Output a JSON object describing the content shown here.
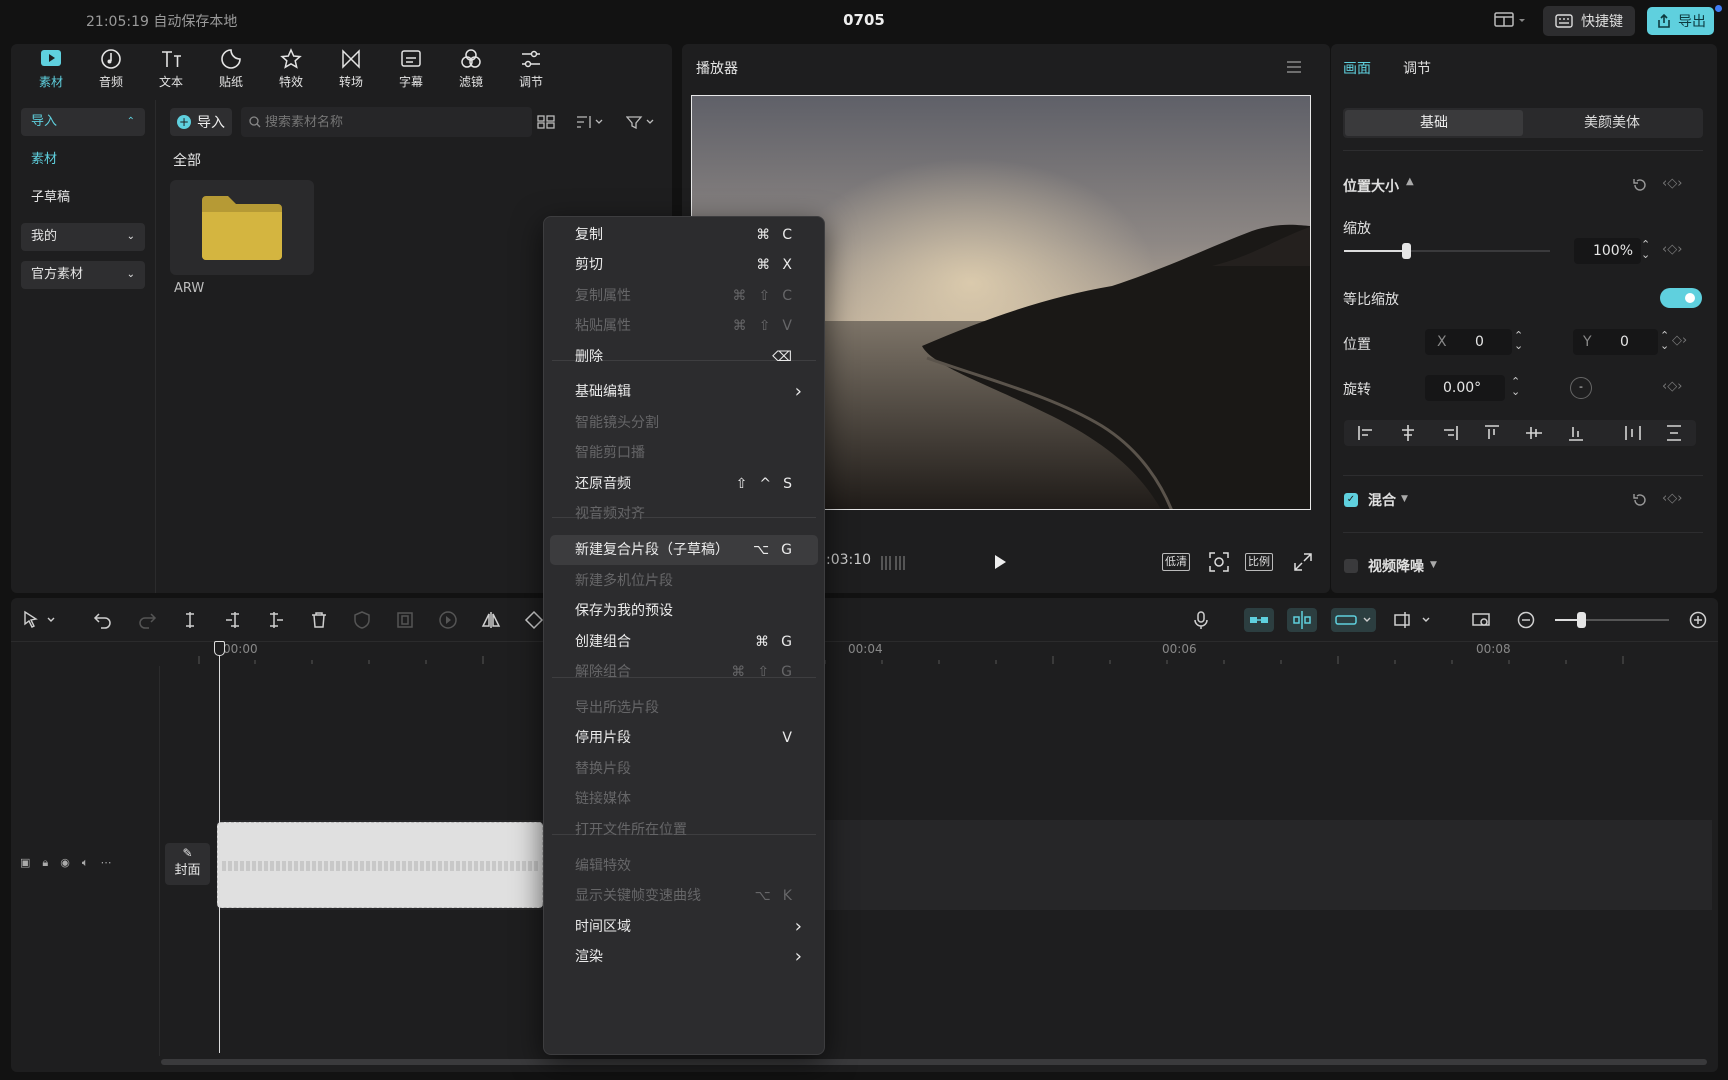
{
  "topbar": {
    "status": "21:05:19 自动保存本地",
    "project_title": "0705",
    "shortcut_label": "快捷键",
    "export_label": "导出"
  },
  "media_tabs": [
    {
      "label": "素材",
      "icon": "media-icon"
    },
    {
      "label": "音频",
      "icon": "audio-icon"
    },
    {
      "label": "文本",
      "icon": "text-icon"
    },
    {
      "label": "贴纸",
      "icon": "sticker-icon"
    },
    {
      "label": "特效",
      "icon": "effects-icon"
    },
    {
      "label": "转场",
      "icon": "transition-icon"
    },
    {
      "label": "字幕",
      "icon": "caption-icon"
    },
    {
      "label": "滤镜",
      "icon": "filter-icon"
    },
    {
      "label": "调节",
      "icon": "adjust-icon"
    }
  ],
  "sidebar": {
    "import": "导入",
    "material": "素材",
    "sub_draft": "子草稿",
    "mine": "我的",
    "official": "官方素材"
  },
  "library": {
    "import_button": "导入",
    "search_placeholder": "搜索素材名称",
    "section_all": "全部",
    "folder_name": "ARW"
  },
  "player": {
    "title": "播放器",
    "time": ":03:10",
    "quality": "低清",
    "ratio": "比例"
  },
  "inspector": {
    "tab_picture": "画面",
    "tab_adjust": "调节",
    "sub_basic": "基础",
    "sub_beauty": "美颜美体",
    "section_position_size": "位置大小",
    "scale_label": "缩放",
    "scale_value": "100%",
    "scale_fraction": 0.3,
    "uniform_scale_label": "等比缩放",
    "position_label": "位置",
    "x_label": "X",
    "x_value": "0",
    "y_label": "Y",
    "y_value": "0",
    "rotate_label": "旋转",
    "rotate_value": "0.00°",
    "blend_label": "混合",
    "denoise_label": "视频降噪"
  },
  "timeline": {
    "ticks": [
      "00:00",
      "00:04",
      "00:06",
      "00:08"
    ],
    "cover_label": "封面"
  },
  "context_menu": [
    {
      "label": "复制",
      "shortcut": "⌘C",
      "enabled": true
    },
    {
      "label": "剪切",
      "shortcut": "⌘X",
      "enabled": true
    },
    {
      "label": "复制属性",
      "shortcut": "⌘⇧C",
      "enabled": false
    },
    {
      "label": "粘贴属性",
      "shortcut": "⌘⇧V",
      "enabled": false
    },
    {
      "label": "删除",
      "shortcut": "⌫",
      "enabled": true
    },
    {
      "label": "基础编辑",
      "shortcut": "›",
      "enabled": true
    },
    {
      "label": "智能镜头分割",
      "shortcut": "",
      "enabled": false
    },
    {
      "label": "智能剪口播",
      "shortcut": "",
      "enabled": false
    },
    {
      "label": "还原音频",
      "shortcut": "⇧^S",
      "enabled": true
    },
    {
      "label": "视音频对齐",
      "shortcut": "",
      "enabled": false
    },
    {
      "label": "新建复合片段（子草稿）",
      "shortcut": "⌥G",
      "enabled": true
    },
    {
      "label": "新建多机位片段",
      "shortcut": "",
      "enabled": false
    },
    {
      "label": "保存为我的预设",
      "shortcut": "",
      "enabled": true
    },
    {
      "label": "创建组合",
      "shortcut": "⌘G",
      "enabled": true
    },
    {
      "label": "解除组合",
      "shortcut": "⌘⇧G",
      "enabled": false
    },
    {
      "label": "导出所选片段",
      "shortcut": "",
      "enabled": false
    },
    {
      "label": "停用片段",
      "shortcut": "V",
      "enabled": true
    },
    {
      "label": "替换片段",
      "shortcut": "",
      "enabled": false
    },
    {
      "label": "链接媒体",
      "shortcut": "",
      "enabled": false
    },
    {
      "label": "打开文件所在位置",
      "shortcut": "",
      "enabled": false
    },
    {
      "label": "编辑特效",
      "shortcut": "",
      "enabled": false
    },
    {
      "label": "显示关键帧变速曲线",
      "shortcut": "⌥K",
      "enabled": false
    },
    {
      "label": "时间区域",
      "shortcut": "›",
      "enabled": true
    },
    {
      "label": "渲染",
      "shortcut": "›",
      "enabled": true
    }
  ],
  "colors": {
    "accent": "#5fd0de",
    "panel": "#1e1e1f",
    "background": "#121212"
  }
}
